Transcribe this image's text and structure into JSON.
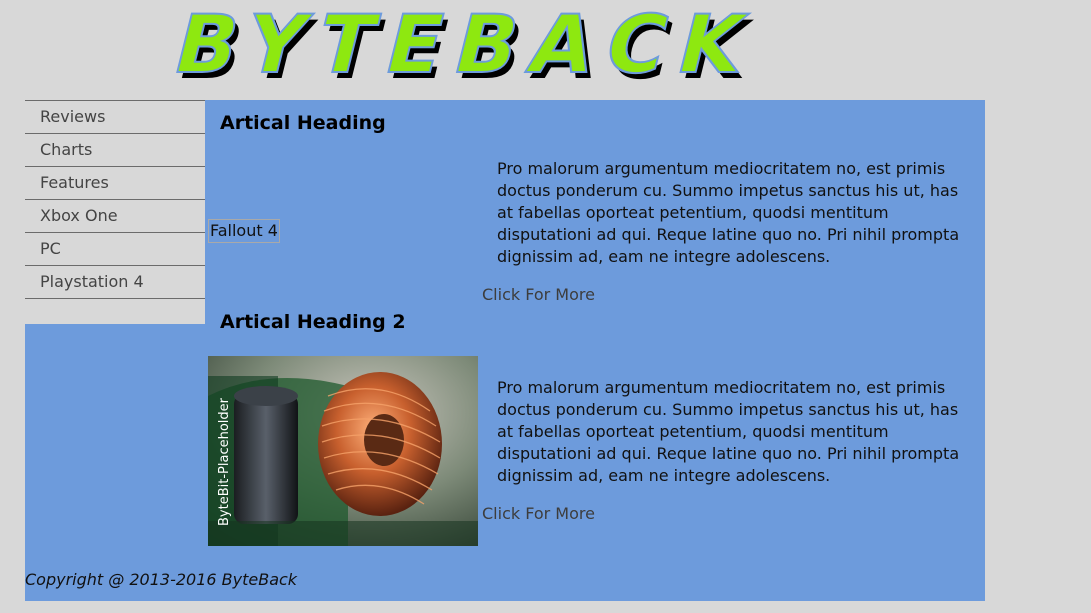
{
  "logo": {
    "text": "BYTEBACK",
    "fill_color": "#8ee810",
    "shadow_color": "#000000",
    "accent_color": "#6d9bdc"
  },
  "nav": {
    "items": [
      {
        "label": "Reviews"
      },
      {
        "label": "Charts"
      },
      {
        "label": "Features"
      },
      {
        "label": "Xbox One"
      },
      {
        "label": "PC"
      },
      {
        "label": "Playstation 4"
      }
    ]
  },
  "articles": [
    {
      "heading": "Artical Heading",
      "image_alt": "Fallout 4",
      "body": "Pro malorum argumentum mediocritatem no, est primis doctus ponderum cu. Summo impetus sanctus his ut, has at fabellas oporteat petentium, quodsi mentitum disputationi ad qui. Reque latine quo no. Pri nihil prompta dignissim ad, eam ne integre adolescens.",
      "more_label": "Click For More"
    },
    {
      "heading": "Artical Heading 2",
      "image_caption": "ByteBit-Placeholder",
      "body": "Pro malorum argumentum mediocritatem no, est primis doctus ponderum cu. Summo impetus sanctus his ut, has at fabellas oporteat petentium, quodsi mentitum disputationi ad qui. Reque latine quo no. Pri nihil prompta dignissim ad, eam ne integre adolescens.",
      "more_label": "Click For More"
    }
  ],
  "footer": {
    "copyright": "Copyright @ 2013-2016 ByteBack"
  },
  "colors": {
    "page_background": "#d8d8d8",
    "content_background": "#6d9bdc",
    "nav_text": "#444444",
    "nav_divider": "#6b6b6b"
  }
}
